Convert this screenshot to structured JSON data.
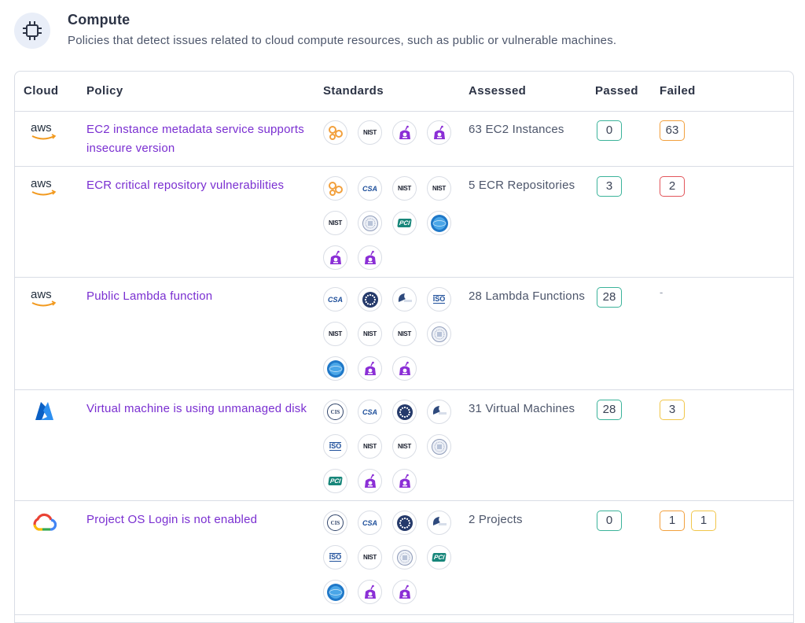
{
  "category": {
    "title": "Compute",
    "description": "Policies that detect issues related to cloud compute resources, such as public or vulnerable machines.",
    "icon": "cpu-chip-icon"
  },
  "table": {
    "headers": {
      "cloud": "Cloud",
      "policy": "Policy",
      "standards": "Standards",
      "assessed": "Assessed",
      "passed": "Passed",
      "failed": "Failed"
    },
    "rows": [
      {
        "cloud": "aws",
        "cloud_label": "aws",
        "policy": "EC2 instance metadata service supports insecure version",
        "standards": [
          "aws-fsbp",
          "nist",
          "mitre",
          "mitre"
        ],
        "assessed": "63 EC2 Instances",
        "passed": [
          "0"
        ],
        "failed": [
          {
            "value": "63",
            "color": "orange"
          }
        ]
      },
      {
        "cloud": "aws",
        "cloud_label": "aws",
        "policy": "ECR critical repository vulnerabilities",
        "standards": [
          "aws-fsbp",
          "csa",
          "nist",
          "nist",
          "nist",
          "seal",
          "pci",
          "globe",
          "mitre",
          "mitre"
        ],
        "assessed": "5 ECR Repositories",
        "passed": [
          "3"
        ],
        "failed": [
          {
            "value": "2",
            "color": "red"
          }
        ]
      },
      {
        "cloud": "aws",
        "cloud_label": "aws",
        "policy": "Public Lambda function",
        "standards": [
          "csa",
          "eu",
          "hipaa",
          "iso",
          "nist",
          "nist",
          "nist",
          "seal",
          "globe",
          "mitre",
          "mitre"
        ],
        "assessed": "28 Lambda Functions",
        "passed": [
          "28"
        ],
        "failed": "-"
      },
      {
        "cloud": "azure",
        "policy": "Virtual machine is using unmanaged disk",
        "standards": [
          "cis",
          "csa",
          "eu",
          "hipaa",
          "iso",
          "nist",
          "nist",
          "seal",
          "pci",
          "mitre",
          "mitre"
        ],
        "assessed": "31 Virtual Machines",
        "passed": [
          "28"
        ],
        "failed": [
          {
            "value": "3",
            "color": "yellow"
          }
        ]
      },
      {
        "cloud": "gcp",
        "policy": "Project OS Login is not enabled",
        "standards": [
          "cis",
          "csa",
          "eu",
          "hipaa",
          "iso",
          "nist",
          "seal",
          "pci",
          "globe",
          "mitre",
          "mitre"
        ],
        "assessed": "2 Projects",
        "passed": [
          "0"
        ],
        "failed": [
          {
            "value": "1",
            "color": "orange"
          },
          {
            "value": "1",
            "color": "yellow"
          }
        ]
      }
    ]
  },
  "standard_labels": {
    "nist": "NIST",
    "csa": "CSA",
    "iso": "ISO",
    "cis": "CIS",
    "pci": "PCI"
  },
  "colors": {
    "link": "#7a2fd1",
    "passed": "#3bb39a",
    "orange": "#f2a03d",
    "red": "#e2555b",
    "yellow": "#f1c64a",
    "mitre": "#8b2fd6"
  }
}
